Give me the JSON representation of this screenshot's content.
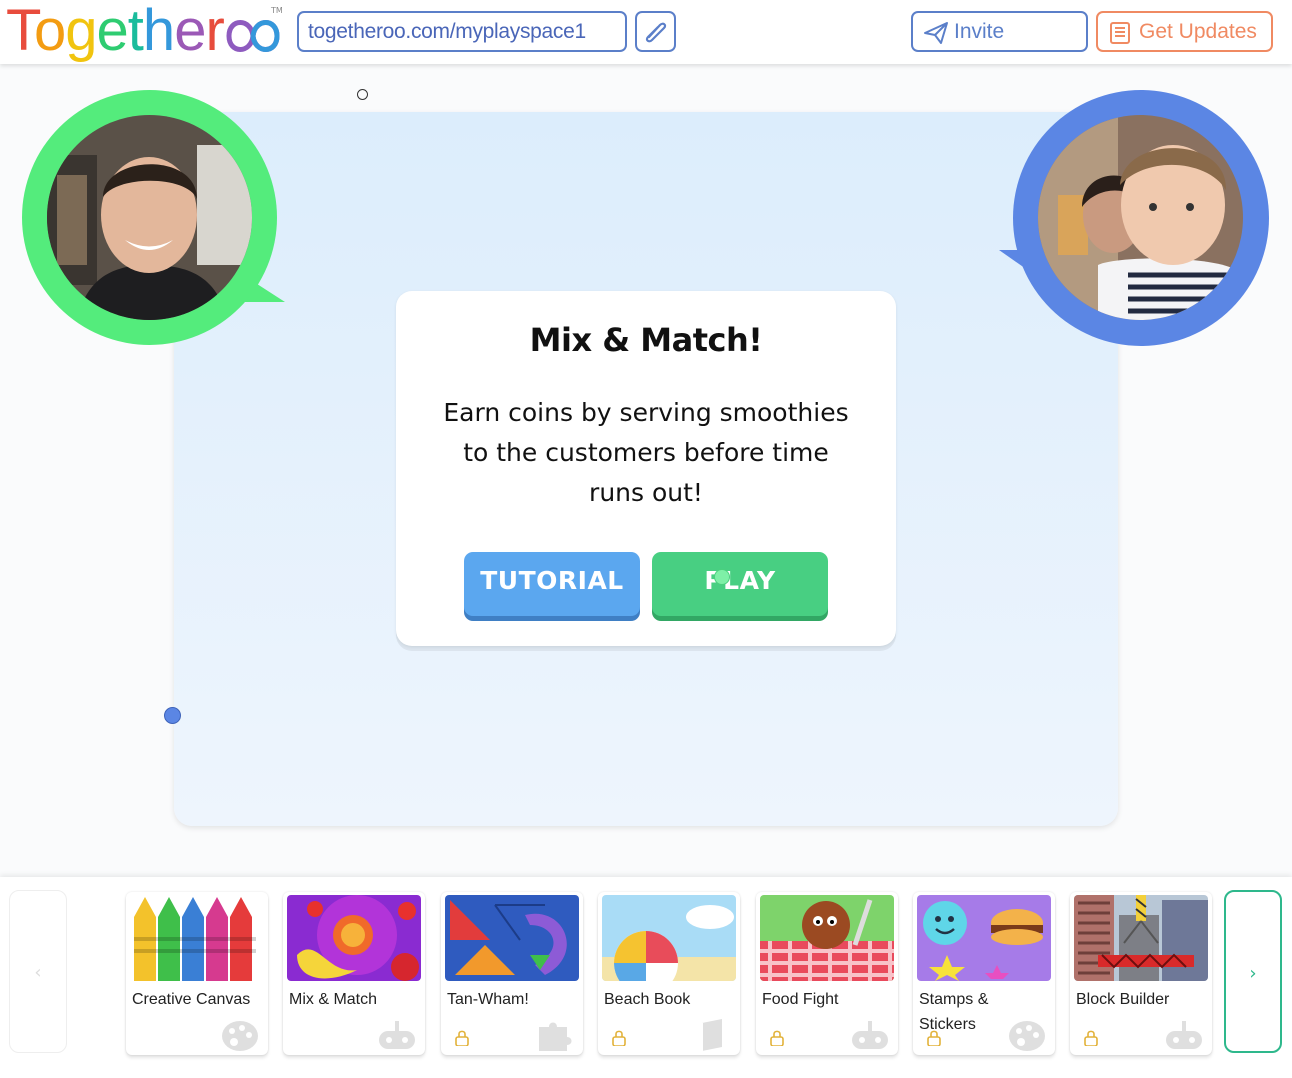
{
  "header": {
    "logo_text": "Togetheroo",
    "logo_letters": [
      "T",
      "o",
      "g",
      "e",
      "t",
      "h",
      "e",
      "r"
    ],
    "trademark": "TM",
    "url": "togetheroo.com/myplayspace1",
    "invite_label": "Invite",
    "updates_label": "Get Updates"
  },
  "game_card": {
    "title": "Mix & Match!",
    "description": "Earn coins by serving smoothies to the customers before time runs out!",
    "tutorial_label": "TUTORIAL",
    "play_label": "PLAY"
  },
  "video": {
    "left_ring_color": "#54ec7c",
    "right_ring_color": "#5b86e4"
  },
  "tray": {
    "prev_label": "‹",
    "next_label": "›",
    "games": [
      {
        "name": "Creative Canvas",
        "locked": false,
        "icon": "palette-icon"
      },
      {
        "name": "Mix & Match",
        "locked": false,
        "icon": "gamepad-icon"
      },
      {
        "name": "Tan-Wham!",
        "locked": true,
        "icon": "puzzle-icon"
      },
      {
        "name": "Beach Book",
        "locked": true,
        "icon": "book-icon"
      },
      {
        "name": "Food Fight",
        "locked": true,
        "icon": "gamepad-icon"
      },
      {
        "name": "Stamps & Stickers",
        "locked": true,
        "icon": "palette-icon"
      },
      {
        "name": "Block Builder",
        "locked": true,
        "icon": "gamepad-icon"
      }
    ]
  }
}
